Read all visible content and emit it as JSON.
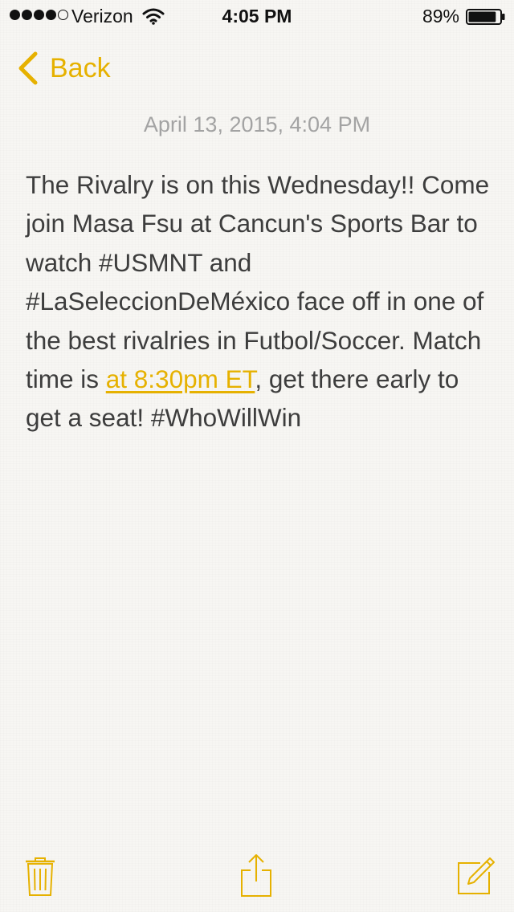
{
  "status_bar": {
    "carrier": "Verizon",
    "time": "4:05 PM",
    "battery_percent": "89%",
    "battery_level": 0.89,
    "signal_bars_filled": 4,
    "signal_bars_total": 5,
    "icons": [
      "wifi-icon",
      "battery-icon"
    ]
  },
  "nav": {
    "back_label": "Back"
  },
  "note": {
    "date": "April 13, 2015, 4:04 PM",
    "body_before_link": "The Rivalry is on this Wednesday!! Come join Masa Fsu at Cancun's Sports Bar to watch #USMNT and #LaSeleccionDeMéxico face off in one of the best rivalries in Futbol/Soccer. Match time is ",
    "link_text": "at 8:30pm ET",
    "body_after_link": ", get there early to get a seat! #WhoWillWin"
  },
  "toolbar": {
    "icons": [
      "trash-icon",
      "share-icon",
      "compose-icon"
    ]
  },
  "colors": {
    "accent": "#e6b100",
    "background": "#f7f6f3",
    "text": "#3d3d3d",
    "date_text": "#a3a3a3"
  }
}
